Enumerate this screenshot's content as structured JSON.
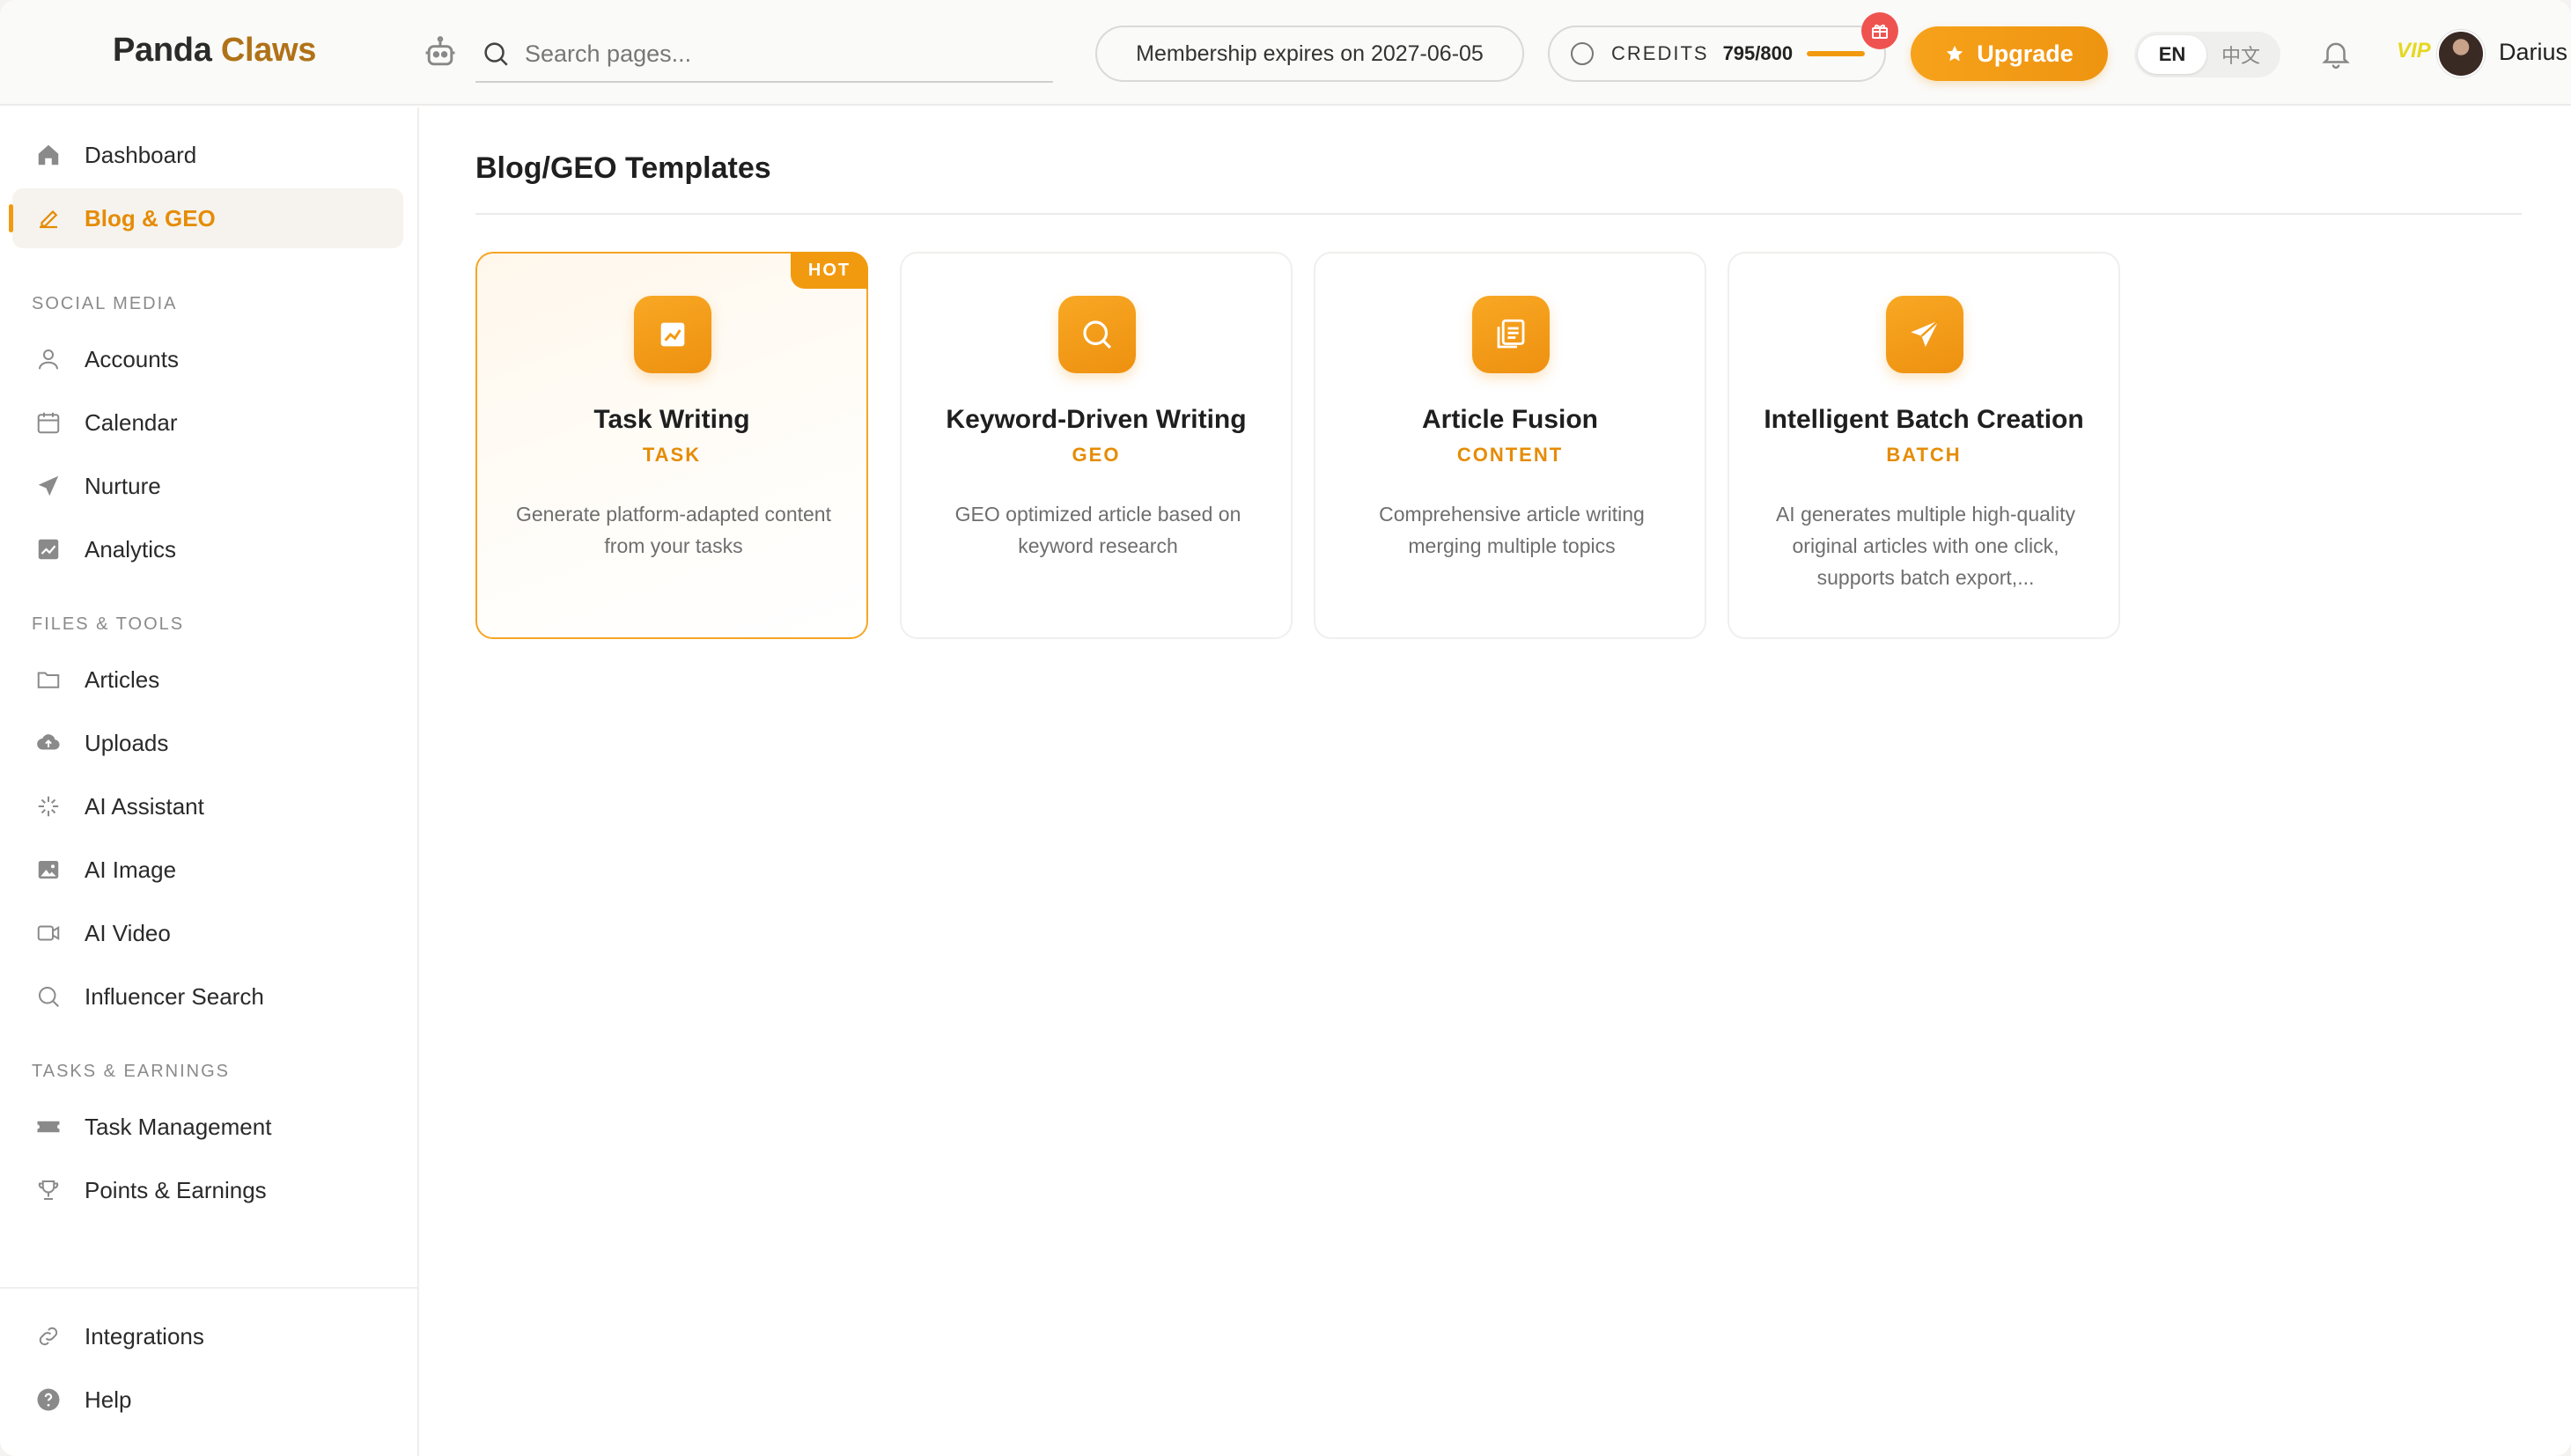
{
  "header": {
    "brand_part1": "Panda",
    "brand_part2": "Claws",
    "search_placeholder": "Search pages...",
    "membership_text": "Membership expires on 2027-06-05",
    "credits_label": "CREDITS",
    "credits_value": "795/800",
    "credits_fraction": 0.99375,
    "upgrade_label": "Upgrade",
    "lang_en": "EN",
    "lang_zh": "中文",
    "vip_text": "VIP",
    "user_name": "Darius"
  },
  "sidebar": {
    "dashboard": "Dashboard",
    "blog_geo": "Blog & GEO",
    "sec_social": "SOCIAL MEDIA",
    "accounts": "Accounts",
    "calendar": "Calendar",
    "nurture": "Nurture",
    "analytics": "Analytics",
    "sec_files": "FILES & TOOLS",
    "articles": "Articles",
    "uploads": "Uploads",
    "ai_assistant": "AI Assistant",
    "ai_image": "AI Image",
    "ai_video": "AI Video",
    "influencer_search": "Influencer Search",
    "sec_tasks": "TASKS & EARNINGS",
    "task_management": "Task Management",
    "points_earnings": "Points & Earnings",
    "integrations": "Integrations",
    "help": "Help"
  },
  "main": {
    "page_title": "Blog/GEO Templates",
    "cards": [
      {
        "title": "Task Writing",
        "tag": "TASK",
        "desc": "Generate platform-adapted content from your tasks",
        "badge": "HOT",
        "icon": "chart-icon"
      },
      {
        "title": "Keyword-Driven Writing",
        "tag": "GEO",
        "desc": "GEO optimized article based on keyword research",
        "icon": "search-icon"
      },
      {
        "title": "Article Fusion",
        "tag": "CONTENT",
        "desc": "Comprehensive article writing merging multiple topics",
        "icon": "documents-icon"
      },
      {
        "title": "Intelligent Batch Creation",
        "tag": "BATCH",
        "desc": "AI generates multiple high-quality original articles with one click, supports batch export,...",
        "icon": "send-icon"
      }
    ]
  },
  "colors": {
    "accent": "#f29a0f",
    "brand_gold": "#b07218",
    "gift_red": "#ef5350"
  }
}
